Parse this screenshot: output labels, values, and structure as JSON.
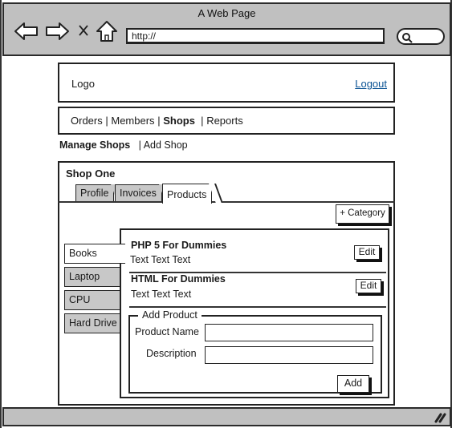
{
  "browser": {
    "window_title": "A Web Page",
    "url": "http://",
    "icons": {
      "back": "arrow-left",
      "forward": "arrow-right",
      "stop": "x",
      "home": "house",
      "search": "magnifier",
      "resize": "resize-grip"
    }
  },
  "header": {
    "logo": "Logo",
    "logout": "Logout"
  },
  "nav": {
    "items": [
      {
        "label": "Orders",
        "active": false
      },
      {
        "label": "Members",
        "active": false
      },
      {
        "label": "Shops",
        "active": true
      },
      {
        "label": "Reports",
        "active": false
      }
    ],
    "separator": "|"
  },
  "subnav": {
    "manage_shops": "Manage Shops",
    "separator": "|",
    "add_shop": "Add Shop"
  },
  "shop": {
    "title": "Shop One",
    "tabs": [
      {
        "label": "Profile",
        "active": false
      },
      {
        "label": "Invoices",
        "active": false
      },
      {
        "label": "Products",
        "active": true
      }
    ],
    "add_category_label": "+ Category",
    "categories": [
      {
        "label": "Books",
        "active": true
      },
      {
        "label": "Laptop",
        "active": false
      },
      {
        "label": "CPU",
        "active": false
      },
      {
        "label": "Hard Drive",
        "active": false
      }
    ],
    "products": [
      {
        "name": "PHP 5 For Dummies",
        "description": "Text Text Text",
        "edit_label": "Edit"
      },
      {
        "name": "HTML For Dummies",
        "description": "Text Text Text",
        "edit_label": "Edit"
      }
    ],
    "add_product": {
      "legend": "Add Product",
      "product_name_label": "Product Name",
      "product_name_value": "",
      "description_label": "Description",
      "description_value": "",
      "add_label": "Add"
    }
  },
  "colors": {
    "chrome_gray": "#c0c0c0",
    "link_blue": "#0b5394",
    "inactive_tab": "#c8c8c8"
  }
}
